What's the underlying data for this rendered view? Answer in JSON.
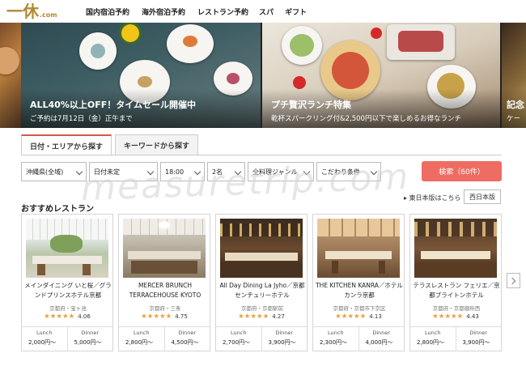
{
  "header": {
    "logo_text": "一休",
    "logo_suffix": ".com",
    "nav": [
      "国内宿泊予約",
      "海外宿泊予約",
      "レストラン予約",
      "スパ",
      "ギフト"
    ]
  },
  "banners": [
    {
      "title": "ALL40%以上OFF！タイムセール開催中",
      "subtitle": "ご予約は7月12日（金）正午まで"
    },
    {
      "title": "プチ贅沢ランチ特集",
      "subtitle": "乾杯スパークリング付&2,500円以下で楽しめるお得なランチ"
    },
    {
      "title": "記念",
      "subtitle": "ケー"
    }
  ],
  "search": {
    "tabs": [
      "日付・エリアから探す",
      "キーワードから探す"
    ],
    "area": "沖縄県(全域)",
    "date": "日付未定",
    "time": "18:00",
    "people": "2名",
    "genre": "全料理ジャンル",
    "conditions": "こだわり条件",
    "button": "検索（60件）"
  },
  "watermark": "measuretrip.com",
  "recommended": {
    "title": "おすすめレストラン",
    "east_link": "▸ 東日本版はこちら",
    "west_button": "西日本版"
  },
  "cards": [
    {
      "name": "メインダイニング いと桜／グランドプリンスホテル京都",
      "location": "京都府・宝ヶ池",
      "stars": "★★★★★",
      "score": "4.06",
      "lunch_label": "Lunch",
      "lunch": "2,000円〜",
      "dinner_label": "Dinner",
      "dinner": "5,000円〜"
    },
    {
      "name": "MERCER BRUNCH TERRACEHOUSE KYOTO",
      "location": "京都府・三条",
      "stars": "★★★★★",
      "score": "4.75",
      "lunch_label": "Lunch",
      "lunch": "2,800円〜",
      "dinner_label": "Dinner",
      "dinner": "4,500円〜"
    },
    {
      "name": "All Day Dining La Jyho／京都センチュリーホテル",
      "location": "京都府・京都駅前",
      "stars": "★★★★★",
      "score": "4.27",
      "lunch_label": "Lunch",
      "lunch": "2,700円〜",
      "dinner_label": "Dinner",
      "dinner": "3,900円〜"
    },
    {
      "name": "THE KITCHEN KANRA／ホテル カンラ京都",
      "location": "京都府・京都市下京区",
      "stars": "★★★★★",
      "score": "4.13",
      "lunch_label": "Lunch",
      "lunch": "2,300円〜",
      "dinner_label": "Dinner",
      "dinner": "4,000円〜"
    },
    {
      "name": "テラスレストラン フェリエ／京都ブライトンホテル",
      "location": "京都府・京都御所西",
      "stars": "★★★★★",
      "score": "4.43",
      "lunch_label": "Lunch",
      "lunch": "2,800円〜",
      "dinner_label": "Dinner",
      "dinner": "3,900円〜"
    }
  ],
  "colors": {
    "brand_gold": "#b08a2f",
    "search_button": "#ef6c62",
    "star": "#e9a23b",
    "active_tab_accent": "#d45a4a"
  },
  "icons": [
    "chevron-down-icon",
    "chevron-right-icon",
    "star-icon"
  ]
}
